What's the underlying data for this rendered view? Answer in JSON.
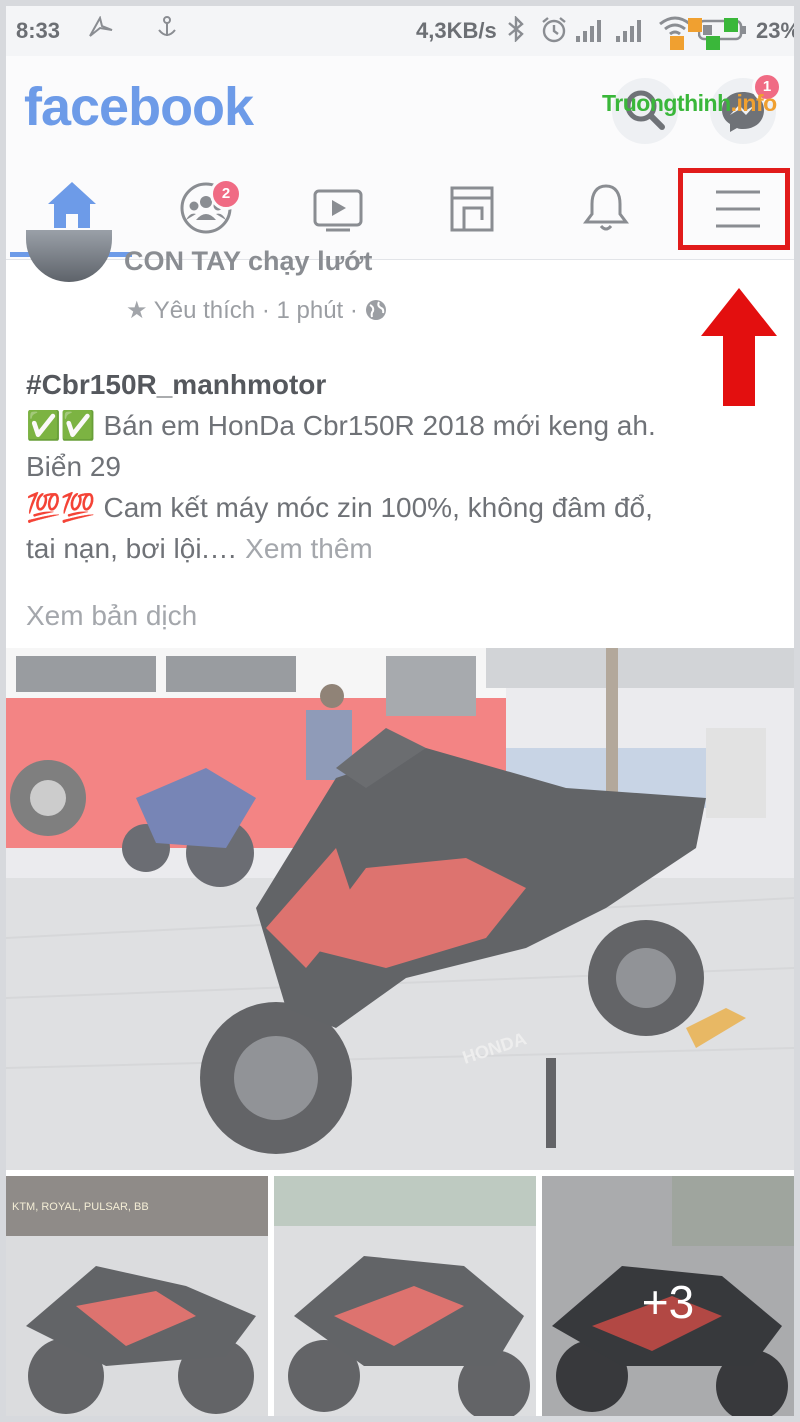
{
  "status_bar": {
    "time": "8:33",
    "net_speed": "4,3KB/s",
    "battery": "23%",
    "icons": [
      "bird-icon",
      "anchor-icon",
      "bluetooth-icon",
      "alarm-icon",
      "signal-icon",
      "signal-icon",
      "wifi-icon",
      "battery-icon"
    ]
  },
  "header": {
    "logo": "facebook",
    "messenger_badge": "1",
    "watermark": {
      "main": "Truongthinh",
      "suffix": ".info"
    }
  },
  "nav": {
    "tabs": [
      {
        "name": "home",
        "icon": "home-icon"
      },
      {
        "name": "groups",
        "icon": "groups-icon",
        "badge": "2"
      },
      {
        "name": "watch",
        "icon": "video-icon"
      },
      {
        "name": "marketplace",
        "icon": "marketplace-icon"
      },
      {
        "name": "notifications",
        "icon": "bell-icon"
      },
      {
        "name": "menu",
        "icon": "hamburger-icon"
      }
    ]
  },
  "post": {
    "author": "CON TAY chạy lướt",
    "meta_label": "Yêu thích",
    "meta_time": "1 phút",
    "hashtag": "#Cbr150R_manhmotor",
    "line1": "✅✅ Bán em HonDa Cbr150R 2018 mới keng ah.",
    "line2": "Biển 29",
    "line3": "💯💯 Cam kết máy móc zin 100%, không đâm đổ,",
    "line4": "tai nạn, bơi lội.…",
    "see_more": "Xem thêm",
    "translate": "Xem bản dịch",
    "photo_text": {
      "brand": "HONDA",
      "sign": "KTM, ROYAL, PULSAR, BB"
    },
    "extra_photos": "+3"
  },
  "colors": {
    "facebook_blue": "#6d9be8",
    "highlight_red": "#e11b1b",
    "badge_pink": "#f06b84"
  }
}
